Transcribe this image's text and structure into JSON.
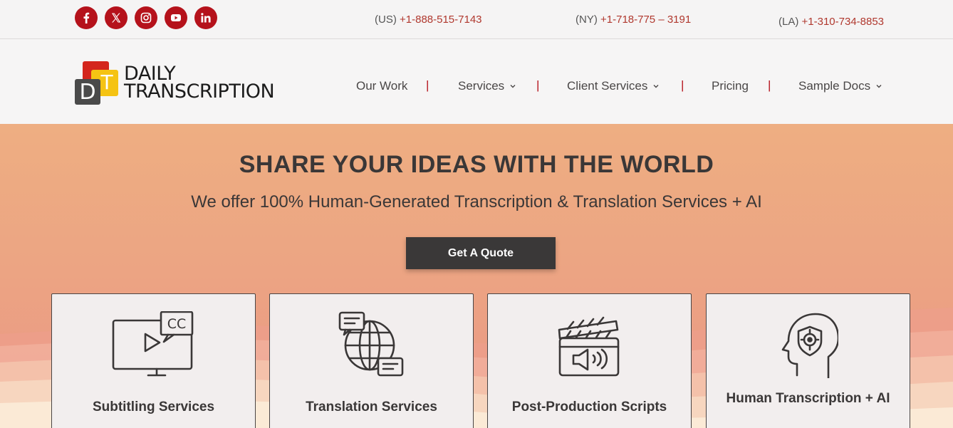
{
  "social": [
    {
      "name": "facebook-icon"
    },
    {
      "name": "x-twitter-icon"
    },
    {
      "name": "instagram-icon"
    },
    {
      "name": "youtube-icon"
    },
    {
      "name": "linkedin-icon"
    }
  ],
  "phones": [
    {
      "region": "(US)",
      "number": "+1-888-515-7143"
    },
    {
      "region": "(NY)",
      "number": "+1-718-775 – 3191"
    },
    {
      "region": "(LA)",
      "number": "+1-310-734-8853"
    }
  ],
  "logo": {
    "line1": "DAILY",
    "line2": "TRANSCRIPTION",
    "badge_d": "D",
    "badge_t": "T"
  },
  "nav": [
    {
      "label": "Our Work",
      "dropdown": false
    },
    {
      "label": "Services",
      "dropdown": true
    },
    {
      "label": "Client Services",
      "dropdown": true
    },
    {
      "label": "Pricing",
      "dropdown": false
    },
    {
      "label": "Sample Docs",
      "dropdown": true
    }
  ],
  "nav_separator": "|",
  "hero": {
    "title": "SHARE YOUR IDEAS WITH THE WORLD",
    "subtitle": "We offer 100% Human-Generated Transcription & Translation Services + AI",
    "cta": "Get A Quote"
  },
  "cards": [
    {
      "label": "Subtitling Services",
      "icon": "subtitles-monitor-icon",
      "cc": "CC"
    },
    {
      "label": "Translation Services",
      "icon": "globe-chat-icon"
    },
    {
      "label": "Post-Production Scripts",
      "icon": "clapperboard-speaker-icon"
    },
    {
      "label": "Human Transcription + AI",
      "icon": "human-ai-head-icon"
    }
  ],
  "colors": {
    "brand_red": "#b5121b",
    "phone_red": "#b0382e",
    "dark": "#3a3838",
    "hero_top": "#eeae82",
    "hero_bottom": "#ea9684"
  }
}
